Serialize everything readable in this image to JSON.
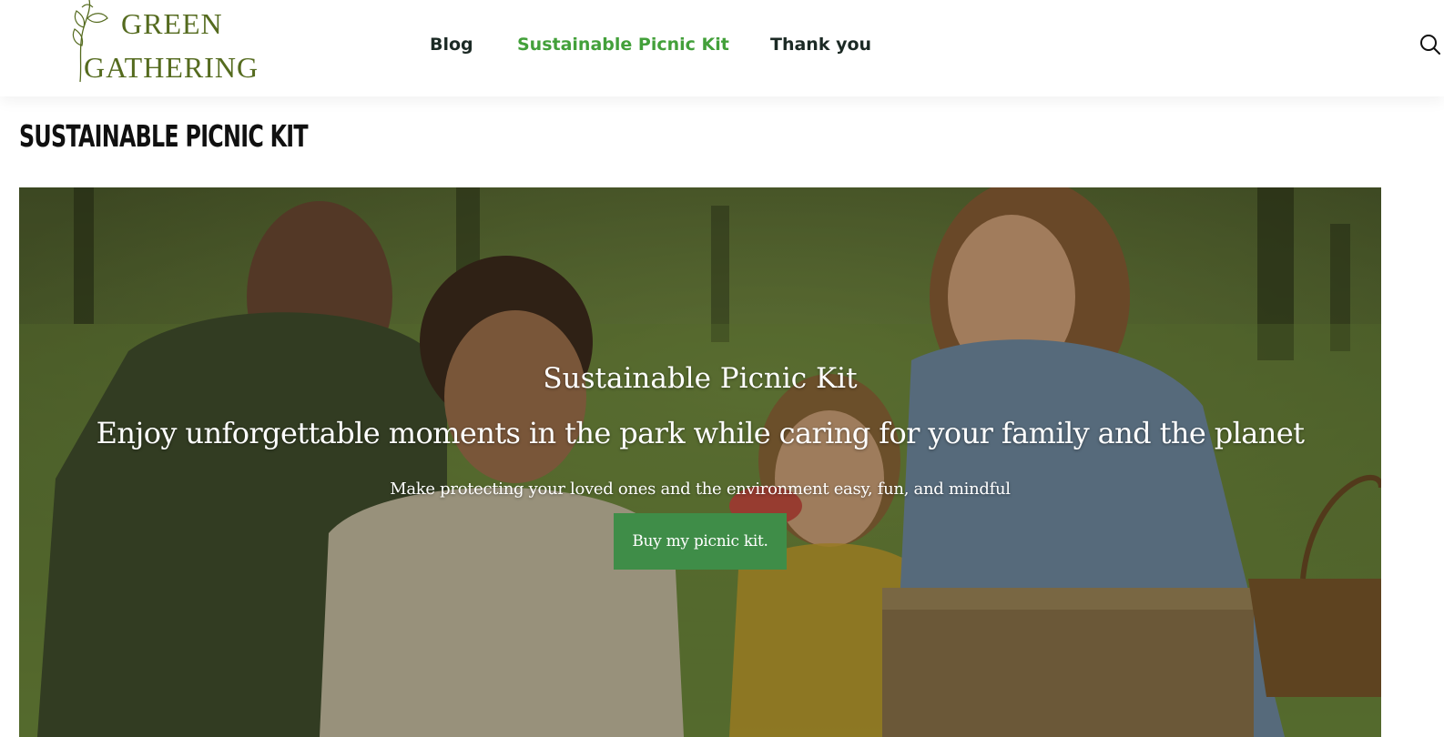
{
  "brand": {
    "name_line1": "GREEN",
    "name_line2": "GATHERING",
    "color": "#556b1f",
    "icon": "leaf-branch-icon"
  },
  "nav": {
    "items": [
      {
        "label": "Blog",
        "active": false
      },
      {
        "label": "Sustainable Picnic Kit",
        "active": true
      },
      {
        "label": "Thank you",
        "active": false
      }
    ],
    "active_color": "#43a03a",
    "text_color": "#1c2a25"
  },
  "header": {
    "search_icon": "search-icon"
  },
  "page": {
    "title": "SUSTAINABLE PICNIC KIT"
  },
  "hero": {
    "title": "Sustainable Picnic Kit",
    "headline": "Enjoy unforgettable moments in the park while caring for your family and the planet",
    "subtitle": "Make protecting your loved ones and the environment easy, fun, and mindful",
    "cta_label": "Buy my picnic kit.",
    "cta_color": "#3f8d48"
  }
}
